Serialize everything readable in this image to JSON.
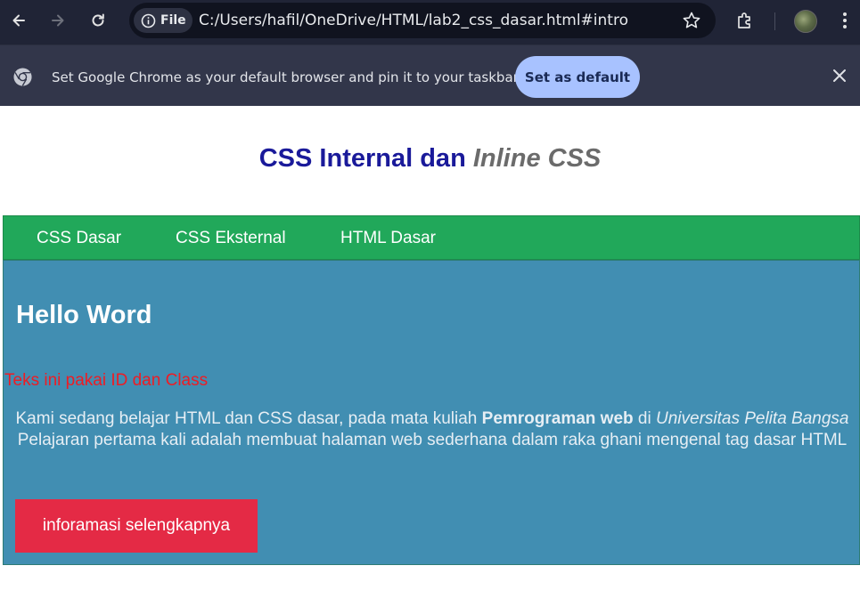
{
  "browser": {
    "site_chip_label": "File",
    "url": "C:/Users/hafil/OneDrive/HTML/lab2_css_dasar.html#intro",
    "infobar_message": "Set Google Chrome as your default browser and pin it to your taskbar",
    "set_default_label": "Set as default"
  },
  "page": {
    "heading_main": "CSS Internal dan ",
    "heading_italic": "Inline CSS",
    "menu": [
      {
        "label": "CSS Dasar"
      },
      {
        "label": "CSS Eksternal"
      },
      {
        "label": "HTML Dasar"
      }
    ],
    "intro": {
      "title": "Hello Word",
      "id_class_text": "Teks ini pakai ID dan Class",
      "desc_part1": "Kami sedang belajar HTML dan CSS dasar, pada mata kuliah ",
      "desc_bold": "Pemrograman web",
      "desc_part2": " di ",
      "desc_italic": "Universitas Pelita Bangsa",
      "desc_part3": " Pelajaran pertama kali adalah membuat halaman web sederhana dalam raka ghani mengenal tag dasar HTML",
      "button_label": "inforamasi selengkapnya"
    }
  }
}
